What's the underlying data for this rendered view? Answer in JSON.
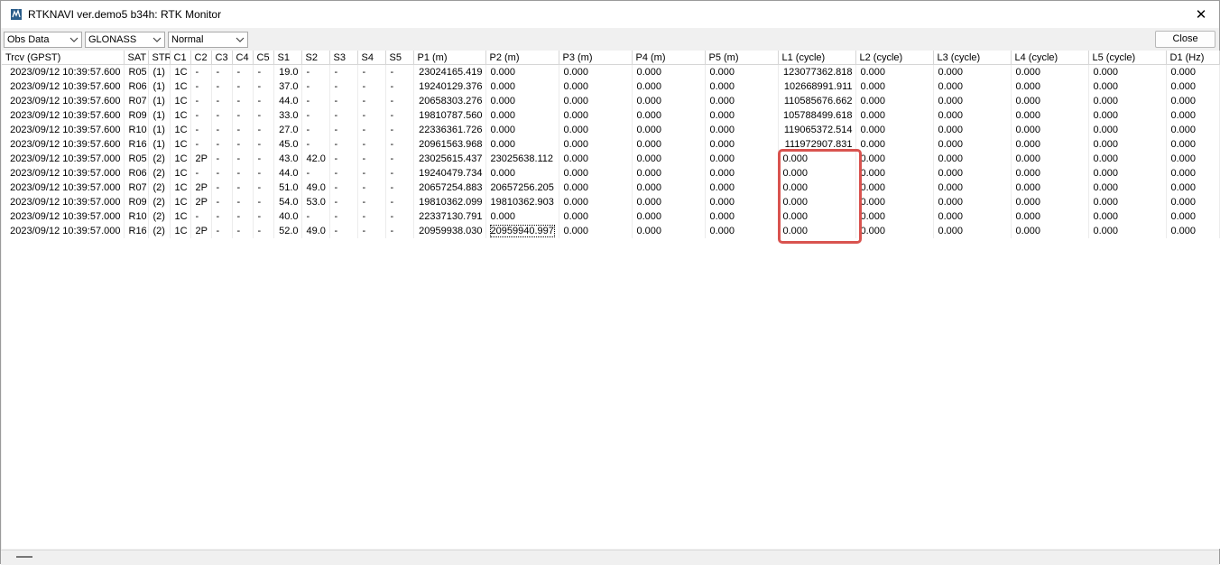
{
  "window": {
    "title": "RTKNAVI ver.demo5 b34h: RTK Monitor",
    "close_glyph": "✕"
  },
  "toolbar": {
    "type_select": "Obs Data",
    "sys_select": "GLONASS",
    "mode_select": "Normal",
    "close_label": "Close"
  },
  "table": {
    "columns": [
      "Trcv (GPST)",
      "SAT",
      "STR",
      "C1",
      "C2",
      "C3",
      "C4",
      "C5",
      "S1",
      "S2",
      "S3",
      "S4",
      "S5",
      "P1 (m)",
      "P2 (m)",
      "P3 (m)",
      "P4 (m)",
      "P5 (m)",
      "L1 (cycle)",
      "L2 (cycle)",
      "L3 (cycle)",
      "L4 (cycle)",
      "L5 (cycle)",
      "D1 (Hz)"
    ],
    "rows": [
      [
        "2023/09/12 10:39:57.600",
        "R05",
        "(1)",
        "1C",
        "-",
        "-",
        "-",
        "-",
        "19.0",
        "-",
        "-",
        "-",
        "-",
        "23024165.419",
        "0.000",
        "0.000",
        "0.000",
        "0.000",
        "123077362.818",
        "0.000",
        "0.000",
        "0.000",
        "0.000",
        "0.000"
      ],
      [
        "2023/09/12 10:39:57.600",
        "R06",
        "(1)",
        "1C",
        "-",
        "-",
        "-",
        "-",
        "37.0",
        "-",
        "-",
        "-",
        "-",
        "19240129.376",
        "0.000",
        "0.000",
        "0.000",
        "0.000",
        "102668991.911",
        "0.000",
        "0.000",
        "0.000",
        "0.000",
        "0.000"
      ],
      [
        "2023/09/12 10:39:57.600",
        "R07",
        "(1)",
        "1C",
        "-",
        "-",
        "-",
        "-",
        "44.0",
        "-",
        "-",
        "-",
        "-",
        "20658303.276",
        "0.000",
        "0.000",
        "0.000",
        "0.000",
        "110585676.662",
        "0.000",
        "0.000",
        "0.000",
        "0.000",
        "0.000"
      ],
      [
        "2023/09/12 10:39:57.600",
        "R09",
        "(1)",
        "1C",
        "-",
        "-",
        "-",
        "-",
        "33.0",
        "-",
        "-",
        "-",
        "-",
        "19810787.560",
        "0.000",
        "0.000",
        "0.000",
        "0.000",
        "105788499.618",
        "0.000",
        "0.000",
        "0.000",
        "0.000",
        "0.000"
      ],
      [
        "2023/09/12 10:39:57.600",
        "R10",
        "(1)",
        "1C",
        "-",
        "-",
        "-",
        "-",
        "27.0",
        "-",
        "-",
        "-",
        "-",
        "22336361.726",
        "0.000",
        "0.000",
        "0.000",
        "0.000",
        "119065372.514",
        "0.000",
        "0.000",
        "0.000",
        "0.000",
        "0.000"
      ],
      [
        "2023/09/12 10:39:57.600",
        "R16",
        "(1)",
        "1C",
        "-",
        "-",
        "-",
        "-",
        "45.0",
        "-",
        "-",
        "-",
        "-",
        "20961563.968",
        "0.000",
        "0.000",
        "0.000",
        "0.000",
        "111972907.831",
        "0.000",
        "0.000",
        "0.000",
        "0.000",
        "0.000"
      ],
      [
        "2023/09/12 10:39:57.000",
        "R05",
        "(2)",
        "1C",
        "2P",
        "-",
        "-",
        "-",
        "43.0",
        "42.0",
        "-",
        "-",
        "-",
        "23025615.437",
        "23025638.112",
        "0.000",
        "0.000",
        "0.000",
        "0.000",
        "0.000",
        "0.000",
        "0.000",
        "0.000",
        "0.000"
      ],
      [
        "2023/09/12 10:39:57.000",
        "R06",
        "(2)",
        "1C",
        "-",
        "-",
        "-",
        "-",
        "44.0",
        "-",
        "-",
        "-",
        "-",
        "19240479.734",
        "0.000",
        "0.000",
        "0.000",
        "0.000",
        "0.000",
        "0.000",
        "0.000",
        "0.000",
        "0.000",
        "0.000"
      ],
      [
        "2023/09/12 10:39:57.000",
        "R07",
        "(2)",
        "1C",
        "2P",
        "-",
        "-",
        "-",
        "51.0",
        "49.0",
        "-",
        "-",
        "-",
        "20657254.883",
        "20657256.205",
        "0.000",
        "0.000",
        "0.000",
        "0.000",
        "0.000",
        "0.000",
        "0.000",
        "0.000",
        "0.000"
      ],
      [
        "2023/09/12 10:39:57.000",
        "R09",
        "(2)",
        "1C",
        "2P",
        "-",
        "-",
        "-",
        "54.0",
        "53.0",
        "-",
        "-",
        "-",
        "19810362.099",
        "19810362.903",
        "0.000",
        "0.000",
        "0.000",
        "0.000",
        "0.000",
        "0.000",
        "0.000",
        "0.000",
        "0.000"
      ],
      [
        "2023/09/12 10:39:57.000",
        "R10",
        "(2)",
        "1C",
        "-",
        "-",
        "-",
        "-",
        "40.0",
        "-",
        "-",
        "-",
        "-",
        "22337130.791",
        "0.000",
        "0.000",
        "0.000",
        "0.000",
        "0.000",
        "0.000",
        "0.000",
        "0.000",
        "0.000",
        "0.000"
      ],
      [
        "2023/09/12 10:39:57.000",
        "R16",
        "(2)",
        "1C",
        "2P",
        "-",
        "-",
        "-",
        "52.0",
        "49.0",
        "-",
        "-",
        "-",
        "20959938.030",
        "20959940.997",
        "0.000",
        "0.000",
        "0.000",
        "0.000",
        "0.000",
        "0.000",
        "0.000",
        "0.000",
        "0.000"
      ]
    ],
    "focused_cell": {
      "row": 11,
      "col": 14
    }
  },
  "annotation": {
    "highlight_color": "#d9534f"
  }
}
